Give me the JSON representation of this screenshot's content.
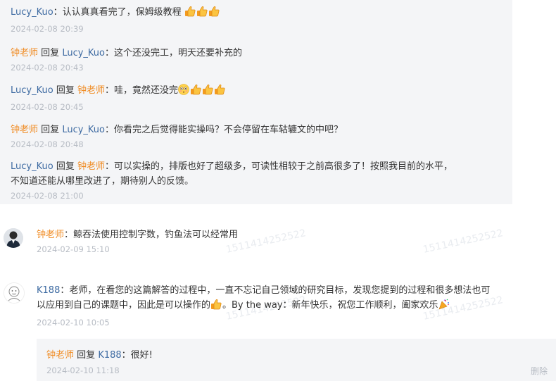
{
  "replies": [
    {
      "author": "Lucy_Kuo",
      "reply_word": "",
      "target": "",
      "content": "：认认真真看完了，保姆级教程",
      "emojis": [
        "thumbs-up",
        "thumbs-up",
        "thumbs-up"
      ],
      "time": "2024-02-08 20:39"
    },
    {
      "author": "钟老师",
      "reply_word": "回复",
      "target": "Lucy_Kuo",
      "content": "：这个还没完工，明天还要补充的",
      "emojis": [],
      "time": "2024-02-08 20:43"
    },
    {
      "author": "Lucy_Kuo",
      "reply_word": "回复",
      "target": "钟老师",
      "content": "：哇，竟然还没完",
      "emojis": [
        "flushed-face",
        "thumbs-up",
        "thumbs-up",
        "thumbs-up"
      ],
      "time": "2024-02-08 20:45"
    },
    {
      "author": "钟老师",
      "reply_word": "回复",
      "target": "Lucy_Kuo",
      "content": "：你看完之后觉得能实操吗？不会停留在车轱辘文的中吧？",
      "emojis": [],
      "time": "2024-02-08 20:48"
    },
    {
      "author": "Lucy_Kuo",
      "reply_word": "回复",
      "target": "钟老师",
      "content_line1": "：可以实操的，排版也好了超级多，可读性相较于之前高很多了！按照我目前的水平，",
      "content_line2": "不知道还能从哪里改进了，期待别人的反馈。",
      "emojis": [],
      "time": "2024-02-08 21:00"
    }
  ],
  "comment1": {
    "author": "钟老师",
    "content": "：鲸吞法使用控制字数，钓鱼法可以经常用",
    "time": "2024-02-09 15:10"
  },
  "comment2": {
    "author": "K188",
    "line1": "：老师，在看您的这篇解答的过程中，一直不忘记自己领域的研究目标，发现您提到的过程和很多想法也可",
    "line2a": "以应用到自己的课题中，因此是可以操作的",
    "line2b": "。By the way：新年快乐，祝您工作顺利，阖家欢乐",
    "time": "2024-02-10 10:05",
    "emojis": [
      "thumbs-up",
      "party-popper"
    ]
  },
  "sub_reply": {
    "author": "钟老师",
    "reply_word": "回复",
    "target": "K188",
    "content": "：很好!",
    "time": "2024-02-10 11:18",
    "delete_label": "删除"
  },
  "watermark": "1511414252522",
  "colors": {
    "name_blue": "#3e6ba2",
    "name_orange": "#f08c24",
    "time_gray": "#b7bcc4",
    "block_bg": "#f4f5f7"
  }
}
